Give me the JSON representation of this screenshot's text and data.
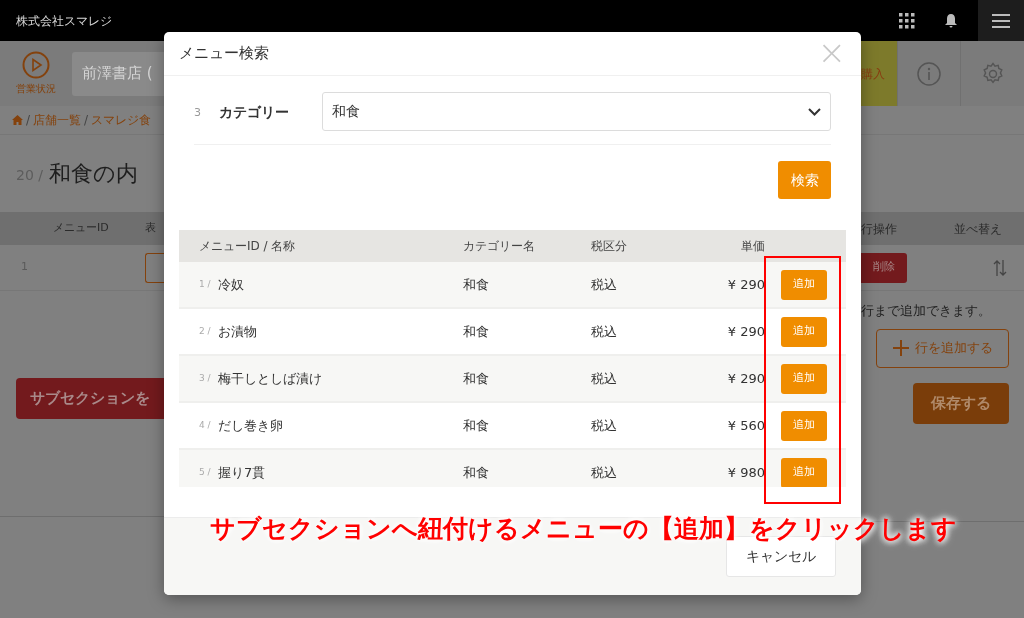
{
  "top_bar": {
    "company": "株式会社スマレジ"
  },
  "header": {
    "status_label": "営業状況",
    "store_field": "前澤書店 (",
    "purchase": "購入"
  },
  "breadcrumb": [
    {
      "separator": "/",
      "label": "店舗一覧"
    },
    {
      "separator": "/",
      "label": "スマレジ食"
    }
  ],
  "page_title": {
    "number": "20 /",
    "title": "和食の内"
  },
  "content_table": {
    "columns_left": [
      "メニューID",
      "表"
    ],
    "columns_right": [
      "行操作",
      "並べ替え"
    ],
    "row_number": "1",
    "delete_button": "削除"
  },
  "limit_note": "行まで追加できます。",
  "add_row_button": "行を追加する",
  "subsection_button": "サブセクションを",
  "save_button": "保存する",
  "modal": {
    "title": "メニュー検索",
    "close": "×",
    "filter": {
      "number": "3",
      "label": "カテゴリー",
      "value": "和食"
    },
    "search_button": "検索",
    "columns": [
      "メニューID / 名称",
      "カテゴリー名",
      "税区分",
      "単価"
    ],
    "rows": [
      {
        "id": "1 /",
        "name": "冷奴",
        "category": "和食",
        "tax": "税込",
        "price": "¥ 290",
        "action": "追加"
      },
      {
        "id": "2 /",
        "name": "お漬物",
        "category": "和食",
        "tax": "税込",
        "price": "¥ 290",
        "action": "追加"
      },
      {
        "id": "3 /",
        "name": "梅干しとしば漬け",
        "category": "和食",
        "tax": "税込",
        "price": "¥ 290",
        "action": "追加"
      },
      {
        "id": "4 /",
        "name": "だし巻き卵",
        "category": "和食",
        "tax": "税込",
        "price": "¥ 560",
        "action": "追加"
      },
      {
        "id": "5 /",
        "name": "握り7貫",
        "category": "和食",
        "tax": "税込",
        "price": "¥ 980",
        "action": "追加"
      }
    ],
    "cancel_button": "キャンセル"
  },
  "annotation": "サブセクションへ紐付けるメニューの【追加】をクリックします"
}
